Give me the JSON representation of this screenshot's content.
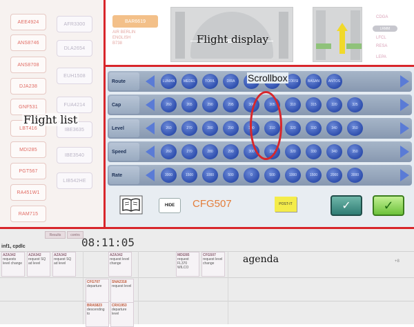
{
  "flight_list": {
    "label": "Flight list",
    "col1": [
      "AEE4924",
      "ANS8746",
      "ANS8708",
      "DJA238",
      "GNF531",
      "LBT416",
      "MDI285",
      "PGT567",
      "RA451W1",
      "RAM715"
    ],
    "col2": [
      "AFR3300",
      "DLA2654",
      "EUH1508",
      "FUA4214",
      "IBE3635",
      "IBE3540",
      "LIB542HE"
    ]
  },
  "flight_display": {
    "label": "Flight display",
    "badge": "BAR6619",
    "info": [
      "AIR BERLIN",
      "ENGLISH",
      "B738"
    ],
    "codes_top": "CDGA",
    "pill": "LRMM",
    "codes": [
      "LFCL",
      "RESA",
      "LEPA"
    ]
  },
  "scrollbox": {
    "label": "Scrollbox",
    "rows": [
      {
        "label": "Route",
        "values": [
          "LUMAN",
          "MEDEL",
          "TORIL",
          "DIRA",
          "",
          "",
          "CORSI",
          "BASAN",
          "ANTOS"
        ]
      },
      {
        "label": "Cap",
        "values": [
          "260",
          "265",
          "290",
          "295",
          "300",
          "305",
          "310",
          "315",
          "320",
          "325"
        ]
      },
      {
        "label": "Level",
        "values": [
          "260",
          "270",
          "280",
          "290",
          "300",
          "310",
          "320",
          "330",
          "340",
          "350"
        ]
      },
      {
        "label": "Speed",
        "values": [
          "260",
          "270",
          "280",
          "290",
          "300",
          "310",
          "320",
          "330",
          "340",
          "350"
        ]
      },
      {
        "label": "Rate",
        "values": [
          "3000",
          "1500",
          "1000",
          "500",
          "0",
          "500",
          "1000",
          "1500",
          "2000",
          "3000"
        ]
      }
    ]
  },
  "toolbar": {
    "hide_label": "HIDE",
    "callsign": "CFG507",
    "postit_label": "POST-IT",
    "confirm_label": "✓",
    "ok_label": "✓"
  },
  "agenda": {
    "label": "agenda",
    "tabs": [
      "Results",
      "contrs"
    ],
    "user": "inf1, cpdlc",
    "clock": "08:11:05",
    "plus": "+8",
    "cards": [
      {
        "title": "AZA342",
        "text": "requests level change"
      },
      {
        "title": "AZA342",
        "text": "request SQ ad level"
      },
      {
        "title": "AZA342",
        "text": "request SQ ad level"
      },
      {
        "title": "AZA342",
        "text": "request level change"
      },
      {
        "title": "MDI285",
        "text": "request FL370 WILCO"
      },
      {
        "title": "CFG507",
        "text": "request level change"
      },
      {
        "title": "CFG707",
        "text": "departure"
      },
      {
        "title": "SNA2318",
        "text": "request level"
      },
      {
        "title": "BRA5823",
        "text": "descending to"
      },
      {
        "title": "CRX1953",
        "text": "departure level"
      }
    ]
  }
}
